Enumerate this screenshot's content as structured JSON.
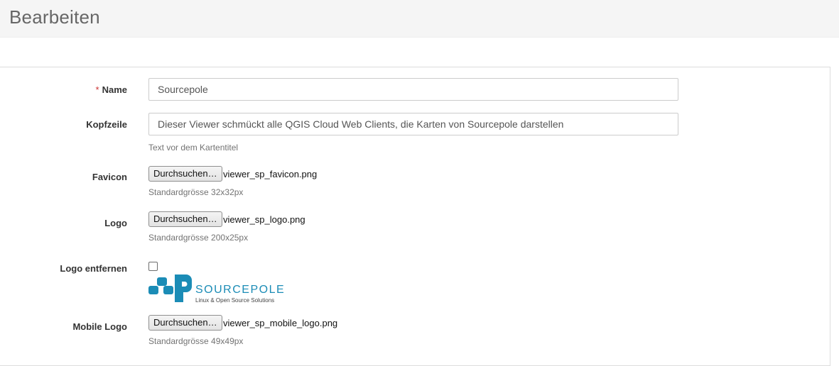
{
  "header": {
    "title": "Bearbeiten"
  },
  "form": {
    "name": {
      "required_mark": "*",
      "label": "Name",
      "value": "Sourcepole"
    },
    "kopfzeile": {
      "label": "Kopfzeile",
      "value": "Dieser Viewer schmückt alle QGIS Cloud Web Clients, die Karten von Sourcepole darstellen",
      "help": "Text vor dem Kartentitel"
    },
    "favicon": {
      "label": "Favicon",
      "button": "Durchsuchen…",
      "file": "viewer_sp_favicon.png",
      "help": "Standardgrösse 32x32px"
    },
    "logo": {
      "label": "Logo",
      "button": "Durchsuchen…",
      "file": "viewer_sp_logo.png",
      "help": "Standardgrösse 200x25px"
    },
    "remove_logo": {
      "label": "Logo entfernen",
      "checked": false,
      "logo_text": "SOURCEPOLE",
      "logo_tagline": "Linux & Open Source Solutions",
      "logo_color": "#1b8cb6"
    },
    "mobile_logo": {
      "label": "Mobile Logo",
      "button": "Durchsuchen…",
      "file": "viewer_sp_mobile_logo.png",
      "help": "Standardgrösse 49x49px"
    }
  }
}
